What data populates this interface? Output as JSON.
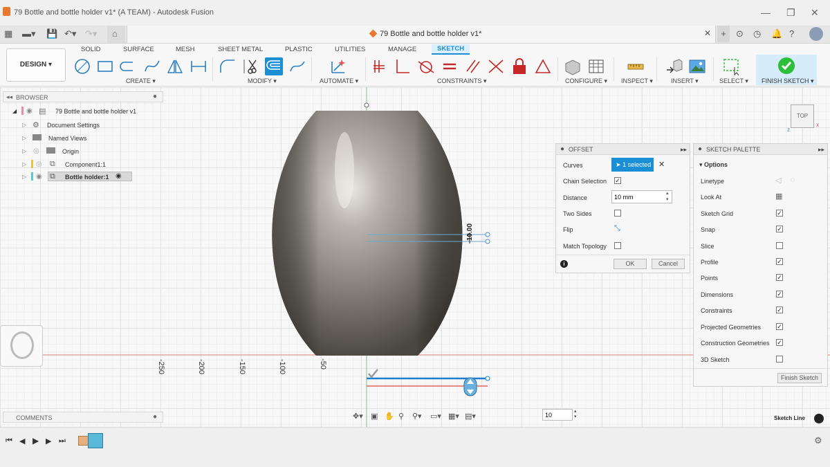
{
  "window": {
    "title": "79 Bottle and bottle holder v1* (A TEAM) - Autodesk Fusion",
    "controls": [
      "—",
      "❐",
      "✕"
    ]
  },
  "doc_tab": {
    "title": "79 Bottle and bottle holder v1*"
  },
  "toolbar": {
    "workspace": "DESIGN ▾",
    "tabs": [
      "SOLID",
      "SURFACE",
      "MESH",
      "SHEET METAL",
      "PLASTIC",
      "UTILITIES",
      "MANAGE",
      "SKETCH"
    ],
    "active_tab": "SKETCH",
    "groups": {
      "create": "CREATE ▾",
      "modify": "MODIFY ▾",
      "automate": "AUTOMATE ▾",
      "constraints": "CONSTRAINTS ▾",
      "configure": "CONFIGURE ▾",
      "inspect": "INSPECT ▾",
      "insert": "INSERT ▾",
      "select": "SELECT ▾",
      "finish": "FINISH SKETCH ▾"
    }
  },
  "browser": {
    "header": "BROWSER",
    "items": [
      {
        "label": "79 Bottle and bottle holder v1"
      },
      {
        "label": "Document Settings"
      },
      {
        "label": "Named Views"
      },
      {
        "label": "Origin"
      },
      {
        "label": "Component1:1"
      },
      {
        "label": "Bottle holder:1"
      }
    ]
  },
  "comments": {
    "header": "COMMENTS"
  },
  "viewcube": {
    "label": "TOP"
  },
  "offset_dialog": {
    "title": "OFFSET",
    "curves_label": "Curves",
    "curves_value": "1 selected",
    "chain_selection_label": "Chain Selection",
    "chain_selection": true,
    "distance_label": "Distance",
    "distance_value": "10 mm",
    "two_sides_label": "Two Sides",
    "two_sides": false,
    "flip_label": "Flip",
    "match_topology_label": "Match Topology",
    "match_topology": false,
    "ok": "OK",
    "cancel": "Cancel"
  },
  "sketch_palette": {
    "title": "SKETCH PALETTE",
    "section": "Options",
    "options": [
      {
        "label": "Linetype",
        "kind": "icons"
      },
      {
        "label": "Look At",
        "kind": "icon"
      },
      {
        "label": "Sketch Grid",
        "checked": true
      },
      {
        "label": "Snap",
        "checked": true
      },
      {
        "label": "Slice",
        "checked": false
      },
      {
        "label": "Profile",
        "checked": true
      },
      {
        "label": "Points",
        "checked": true
      },
      {
        "label": "Dimensions",
        "checked": true
      },
      {
        "label": "Constraints",
        "checked": true
      },
      {
        "label": "Projected Geometries",
        "checked": true
      },
      {
        "label": "Construction Geometries",
        "checked": true
      },
      {
        "label": "3D Sketch",
        "checked": false
      }
    ],
    "finish_button": "Finish Sketch"
  },
  "canvas": {
    "ruler_labels": [
      "-250",
      "-200",
      "-150",
      "-100",
      "-50"
    ],
    "dimension_label": "10.00",
    "offset_input": "10",
    "status": "Sketch Line"
  },
  "colors": {
    "accent": "#1a8fd6",
    "finish_green": "#2bbf3a",
    "body_dark": "#5a5651",
    "axis_red": "#d9534f"
  }
}
